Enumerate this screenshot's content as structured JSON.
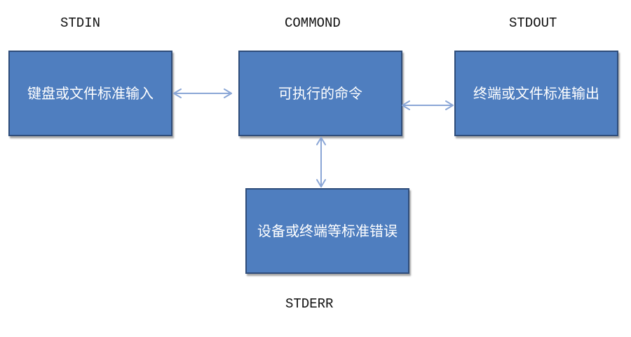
{
  "labels": {
    "stdin": "STDIN",
    "command": "COMMOND",
    "stdout": "STDOUT",
    "stderr": "STDERR"
  },
  "boxes": {
    "input": "键盘或文件标准输入",
    "command": "可执行的命令",
    "output": "终端或文件标准输出",
    "error": "设备或终端等标准错误"
  },
  "colors": {
    "box_fill": "#4f7ebf",
    "box_border": "#2f4d7a",
    "arrow": "#8aa6d6"
  }
}
